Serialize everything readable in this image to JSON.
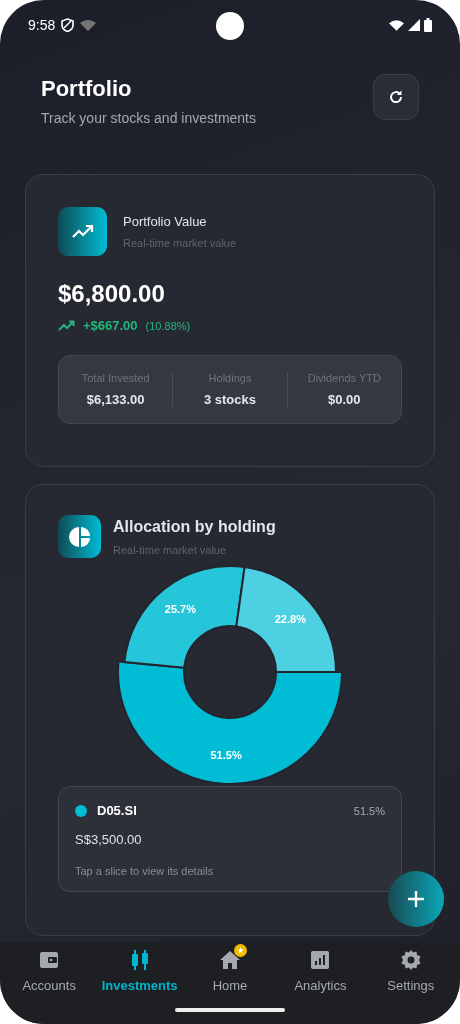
{
  "status_bar": {
    "time": "9:58"
  },
  "header": {
    "title": "Portfolio",
    "subtitle": "Track your stocks and investments"
  },
  "value_card": {
    "title": "Portfolio Value",
    "subtitle": "Real-time market value",
    "total": "$6,800.00",
    "change": "+$667.00",
    "change_percent": "(10.88%)",
    "stats": [
      {
        "label": "Total Invested",
        "value": "$6,133.00"
      },
      {
        "label": "Holdings",
        "value": "3 stocks"
      },
      {
        "label": "Dividends YTD",
        "value": "$0.00"
      }
    ]
  },
  "allocation_card": {
    "title": "Allocation by holding",
    "subtitle": "Real-time market value",
    "chart_data": {
      "type": "donut",
      "values": [
        51.5,
        25.7,
        22.8
      ],
      "data_labels": true,
      "value_labels": [
        "51.5%",
        "25.7%",
        "22.8%"
      ]
    },
    "detail": {
      "symbol": "D05.SI",
      "color": "#00bcd4",
      "percent": "51.5%",
      "amount": "S$3,500.00",
      "hint": "Tap a slice to view its details"
    }
  },
  "nav": [
    {
      "label": "Accounts",
      "kind": "wallet",
      "selected": false,
      "badge": false
    },
    {
      "label": "Investments",
      "kind": "candles",
      "selected": true,
      "badge": false
    },
    {
      "label": "Home",
      "kind": "home",
      "selected": false,
      "badge": true
    },
    {
      "label": "Analytics",
      "kind": "chart",
      "selected": false,
      "badge": false
    },
    {
      "label": "Settings",
      "kind": "gear",
      "selected": false,
      "badge": false
    }
  ]
}
